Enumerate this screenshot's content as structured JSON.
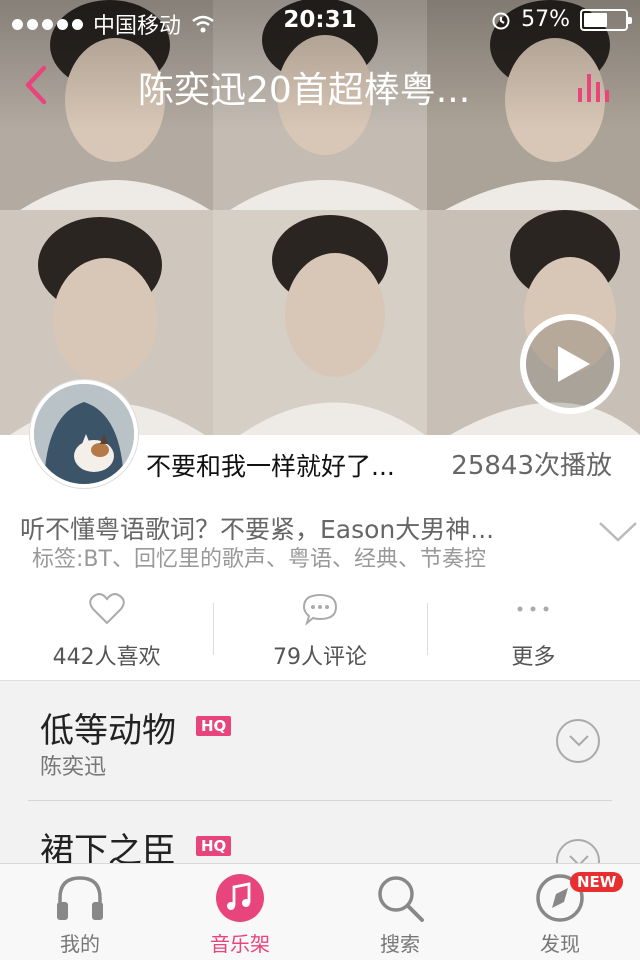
{
  "status_bar": {
    "carrier": "中国移动",
    "time": "20:31",
    "battery_percent": "57%",
    "battery_level": 0.57
  },
  "nav": {
    "title": "陈奕迅20首超棒粤...",
    "back_icon": "chevron-left-icon",
    "equalizer_icon": "equalizer-icon",
    "accent_color": "#e8457c"
  },
  "playlist": {
    "creator": "不要和我一样就好了...",
    "play_count": "25843次播放",
    "description": "听不懂粤语歌词？不要紧，Eason大男神...",
    "tags": "标签:BT、回忆里的歌声、粤语、经典、节奏控"
  },
  "actions": [
    {
      "icon": "heart-icon",
      "label": "442人喜欢"
    },
    {
      "icon": "comment-icon",
      "label": "79人评论"
    },
    {
      "icon": "more-icon",
      "label": "更多"
    }
  ],
  "songs": [
    {
      "title": "低等动物",
      "badge": "HQ",
      "artist": "陈奕迅"
    },
    {
      "title": "裙下之臣",
      "badge": "HQ",
      "artist": ""
    }
  ],
  "tabs": [
    {
      "icon": "headphones-icon",
      "label": "我的",
      "active": false
    },
    {
      "icon": "music-note-icon",
      "label": "音乐架",
      "active": true
    },
    {
      "icon": "search-icon",
      "label": "搜索",
      "active": false
    },
    {
      "icon": "compass-icon",
      "label": "发现",
      "active": false,
      "badge": "NEW"
    }
  ]
}
